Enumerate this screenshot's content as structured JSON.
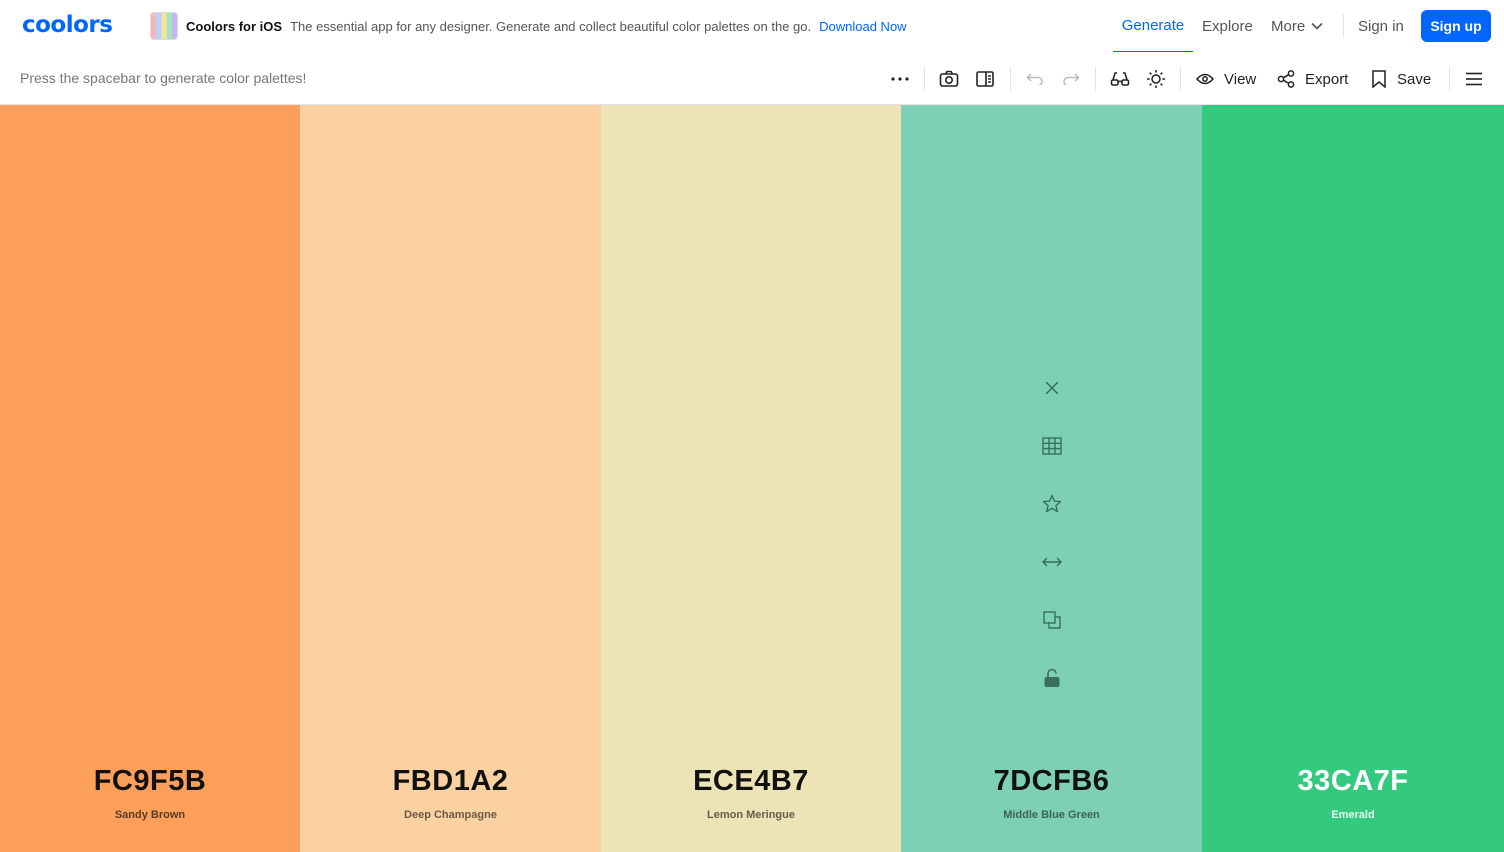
{
  "nav": {
    "logo": "coolors",
    "promo_title": "Coolors for iOS",
    "promo_text": "The essential app for any designer. Generate and collect beautiful color palettes on the go.",
    "promo_link": "Download Now",
    "links": {
      "generate": "Generate",
      "explore": "Explore",
      "more": "More"
    },
    "sign_in": "Sign in",
    "sign_up": "Sign up"
  },
  "toolbar": {
    "hint": "Press the spacebar to generate color palettes!",
    "view": "View",
    "export": "Export",
    "save": "Save",
    "icons": [
      "more-dots-icon",
      "camera-icon",
      "side-panel-icon",
      "undo-icon",
      "redo-icon",
      "glasses-icon",
      "sun-icon",
      "eye-icon",
      "share-icon",
      "bookmark-icon",
      "hamburger-icon"
    ]
  },
  "palette": [
    {
      "hex": "FC9F5B",
      "name": "Sandy Brown",
      "color": "#FC9F5B",
      "text_color": "#111111",
      "sub_color": "#5a3a22"
    },
    {
      "hex": "FBD1A2",
      "name": "Deep Champagne",
      "color": "#FBD1A2",
      "text_color": "#111111",
      "sub_color": "#6b5a45"
    },
    {
      "hex": "ECE4B7",
      "name": "Lemon Meringue",
      "color": "#ECE4B7",
      "text_color": "#111111",
      "sub_color": "#625e4a"
    },
    {
      "hex": "7DCFB6",
      "name": "Middle Blue Green",
      "color": "#7DCFB6",
      "text_color": "#111111",
      "sub_color": "#3d6358"
    },
    {
      "hex": "33CA7F",
      "name": "Emerald",
      "color": "#33CA7F",
      "text_color": "#ffffff",
      "sub_color": "#e8fbf1"
    }
  ],
  "swatch_tools": [
    "close-icon",
    "grid-icon",
    "star-icon",
    "drag-arrows-icon",
    "copy-icon",
    "unlock-icon"
  ]
}
